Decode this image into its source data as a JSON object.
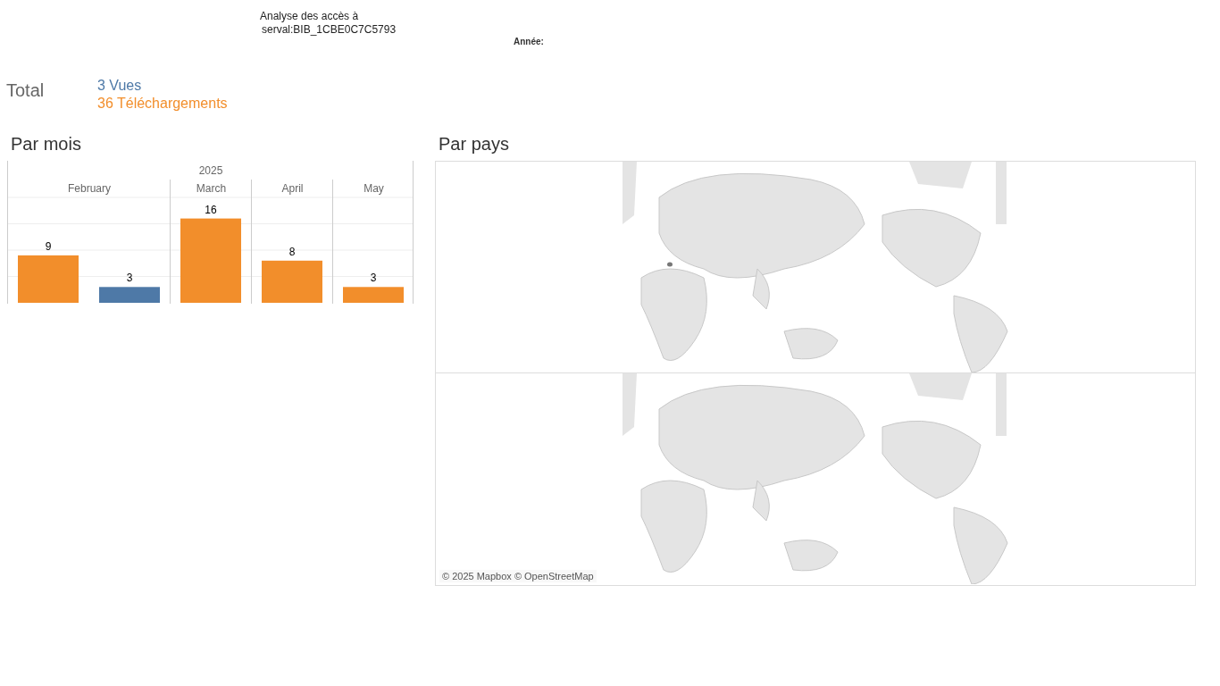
{
  "header": {
    "title": "Analyse des accès à",
    "subtitle": "serval:BIB_1CBE0C7C5793",
    "filter_label": "Année:"
  },
  "total": {
    "label": "Total",
    "items": [
      {
        "text": "3 Vues",
        "color": "#4e79a7"
      },
      {
        "text": "36 Téléchargements",
        "color": "#f28e2b"
      }
    ]
  },
  "par_mois": {
    "title": "Par mois",
    "year": "2025",
    "chart_data": {
      "type": "bar",
      "categories": [
        "February",
        "March",
        "April",
        "May"
      ],
      "ylim": [
        0,
        20
      ],
      "data_labels": true,
      "series": [
        {
          "color": "#f28e2b",
          "values": [
            9,
            16,
            8,
            3
          ]
        },
        {
          "color": "#4e79a7",
          "values": [
            3,
            null,
            null,
            null
          ]
        }
      ]
    }
  },
  "par_pays": {
    "title": "Par pays",
    "attribution": "© 2025 Mapbox © OpenStreetMap"
  }
}
